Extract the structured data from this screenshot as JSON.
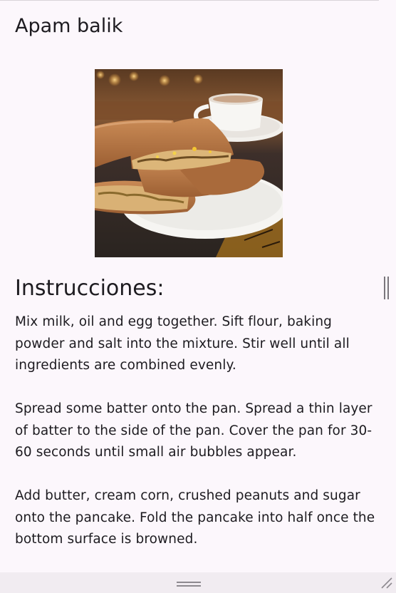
{
  "recipe": {
    "title": "Apam balik",
    "image_icon": "apam-balik-photo",
    "section_title": "Instrucciones:",
    "steps": [
      "Mix milk, oil and egg together. Sift flour, baking powder and salt into the mixture. Stir well until all ingredients are combined evenly.",
      "Spread some batter onto the pan. Spread a thin layer of batter to the side of the pan. Cover the pan for 30-60 seconds until small air bubbles appear.",
      "Add butter, cream corn, crushed peanuts and sugar onto the pancake. Fold the pancake into half once the bottom surface is browned."
    ]
  },
  "colors": {
    "background": "#fcf7fc",
    "bottom_bar": "#f1ecf1",
    "text": "#1d1b20",
    "scrollbar": "#7a767c"
  },
  "icons": {
    "scroll": "scrollbar-thumb-icon",
    "drag": "drag-handle-icon",
    "resize": "resize-grip-icon"
  }
}
